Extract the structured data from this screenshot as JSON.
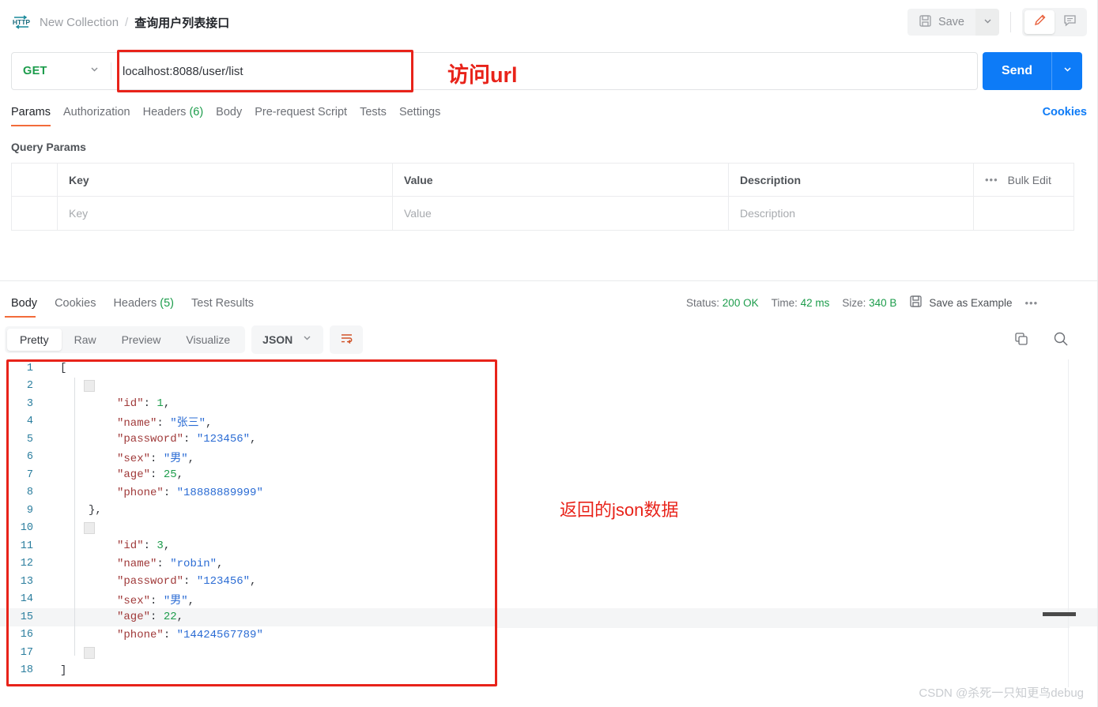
{
  "header": {
    "icon": "http-icon",
    "breadcrumb": {
      "collection": "New Collection",
      "separator": "/",
      "current": "查询用户列表接口"
    },
    "save_label": "Save",
    "save_icon": "floppy-disk-icon",
    "save_caret_icon": "chevron-down-icon",
    "edit_icon": "pencil-icon",
    "comment_icon": "comment-icon"
  },
  "request": {
    "method": "GET",
    "method_caret_icon": "chevron-down-icon",
    "url": "localhost:8088/user/list",
    "send_label": "Send",
    "send_caret_icon": "chevron-down-icon",
    "tabs": [
      {
        "label": "Params",
        "count": "",
        "active": true
      },
      {
        "label": "Authorization",
        "count": "",
        "active": false
      },
      {
        "label": "Headers",
        "count": "(6)",
        "active": false
      },
      {
        "label": "Body",
        "count": "",
        "active": false
      },
      {
        "label": "Pre-request Script",
        "count": "",
        "active": false
      },
      {
        "label": "Tests",
        "count": "",
        "active": false
      },
      {
        "label": "Settings",
        "count": "",
        "active": false
      }
    ],
    "cookies_link": "Cookies",
    "query_params_title": "Query Params",
    "params_table": {
      "headers": [
        "Key",
        "Value",
        "Description"
      ],
      "dots_icon": "ellipsis-icon",
      "bulk_edit": "Bulk Edit",
      "rows": [
        {
          "key": "Key",
          "value": "Value",
          "description": "Description"
        }
      ]
    }
  },
  "response": {
    "tabs": [
      {
        "label": "Body",
        "count": "",
        "active": true
      },
      {
        "label": "Cookies",
        "count": "",
        "active": false
      },
      {
        "label": "Headers",
        "count": "(5)",
        "active": false
      },
      {
        "label": "Test Results",
        "count": "",
        "active": false
      }
    ],
    "meta": {
      "status_label": "Status:",
      "status_value": "200 OK",
      "time_label": "Time:",
      "time_value": "42 ms",
      "size_label": "Size:",
      "size_value": "340 B",
      "save_example_label": "Save as Example",
      "save_example_icon": "floppy-disk-icon",
      "more_icon": "ellipsis-icon"
    },
    "viewer": {
      "modes": [
        {
          "label": "Pretty",
          "active": true
        },
        {
          "label": "Raw",
          "active": false
        },
        {
          "label": "Preview",
          "active": false
        },
        {
          "label": "Visualize",
          "active": false
        }
      ],
      "format": "JSON",
      "format_caret_icon": "chevron-down-icon",
      "wrap_icon": "wrap-lines-icon",
      "copy_icon": "copy-icon",
      "search_icon": "search-icon"
    },
    "body_lines": [
      {
        "no": "1",
        "indent": 0,
        "tokens": [
          {
            "t": "p",
            "v": "["
          }
        ]
      },
      {
        "no": "2",
        "indent": 1,
        "tokens": [
          {
            "t": "p",
            "v": "{"
          }
        ]
      },
      {
        "no": "3",
        "indent": 2,
        "tokens": [
          {
            "t": "k",
            "v": "\"id\""
          },
          {
            "t": "p",
            "v": ": "
          },
          {
            "t": "n",
            "v": "1"
          },
          {
            "t": "p",
            "v": ","
          }
        ]
      },
      {
        "no": "4",
        "indent": 2,
        "tokens": [
          {
            "t": "k",
            "v": "\"name\""
          },
          {
            "t": "p",
            "v": ": "
          },
          {
            "t": "s",
            "v": "\"张三\""
          },
          {
            "t": "p",
            "v": ","
          }
        ]
      },
      {
        "no": "5",
        "indent": 2,
        "tokens": [
          {
            "t": "k",
            "v": "\"password\""
          },
          {
            "t": "p",
            "v": ": "
          },
          {
            "t": "s",
            "v": "\"123456\""
          },
          {
            "t": "p",
            "v": ","
          }
        ]
      },
      {
        "no": "6",
        "indent": 2,
        "tokens": [
          {
            "t": "k",
            "v": "\"sex\""
          },
          {
            "t": "p",
            "v": ": "
          },
          {
            "t": "s",
            "v": "\"男\""
          },
          {
            "t": "p",
            "v": ","
          }
        ]
      },
      {
        "no": "7",
        "indent": 2,
        "tokens": [
          {
            "t": "k",
            "v": "\"age\""
          },
          {
            "t": "p",
            "v": ": "
          },
          {
            "t": "n",
            "v": "25"
          },
          {
            "t": "p",
            "v": ","
          }
        ]
      },
      {
        "no": "8",
        "indent": 2,
        "tokens": [
          {
            "t": "k",
            "v": "\"phone\""
          },
          {
            "t": "p",
            "v": ": "
          },
          {
            "t": "s",
            "v": "\"18888889999\""
          }
        ]
      },
      {
        "no": "9",
        "indent": 1,
        "tokens": [
          {
            "t": "p",
            "v": "},"
          }
        ]
      },
      {
        "no": "10",
        "indent": 1,
        "tokens": [
          {
            "t": "p",
            "v": "{"
          }
        ]
      },
      {
        "no": "11",
        "indent": 2,
        "tokens": [
          {
            "t": "k",
            "v": "\"id\""
          },
          {
            "t": "p",
            "v": ": "
          },
          {
            "t": "n",
            "v": "3"
          },
          {
            "t": "p",
            "v": ","
          }
        ]
      },
      {
        "no": "12",
        "indent": 2,
        "tokens": [
          {
            "t": "k",
            "v": "\"name\""
          },
          {
            "t": "p",
            "v": ": "
          },
          {
            "t": "s",
            "v": "\"robin\""
          },
          {
            "t": "p",
            "v": ","
          }
        ]
      },
      {
        "no": "13",
        "indent": 2,
        "tokens": [
          {
            "t": "k",
            "v": "\"password\""
          },
          {
            "t": "p",
            "v": ": "
          },
          {
            "t": "s",
            "v": "\"123456\""
          },
          {
            "t": "p",
            "v": ","
          }
        ]
      },
      {
        "no": "14",
        "indent": 2,
        "tokens": [
          {
            "t": "k",
            "v": "\"sex\""
          },
          {
            "t": "p",
            "v": ": "
          },
          {
            "t": "s",
            "v": "\"男\""
          },
          {
            "t": "p",
            "v": ","
          }
        ]
      },
      {
        "no": "15",
        "indent": 2,
        "highlight": true,
        "tokens": [
          {
            "t": "k",
            "v": "\"age\""
          },
          {
            "t": "p",
            "v": ": "
          },
          {
            "t": "n",
            "v": "22"
          },
          {
            "t": "p",
            "v": ","
          }
        ]
      },
      {
        "no": "16",
        "indent": 2,
        "tokens": [
          {
            "t": "k",
            "v": "\"phone\""
          },
          {
            "t": "p",
            "v": ": "
          },
          {
            "t": "s",
            "v": "\"14424567789\""
          }
        ]
      },
      {
        "no": "17",
        "indent": 1,
        "tokens": [
          {
            "t": "p",
            "v": "}"
          }
        ]
      },
      {
        "no": "18",
        "indent": 0,
        "tokens": [
          {
            "t": "p",
            "v": "]"
          }
        ]
      }
    ]
  },
  "annotations": {
    "url_note": "访问url",
    "json_note": "返回的json数据",
    "box_color": "#e8231a"
  },
  "watermark": "CSDN @杀死一只知更鸟debug"
}
